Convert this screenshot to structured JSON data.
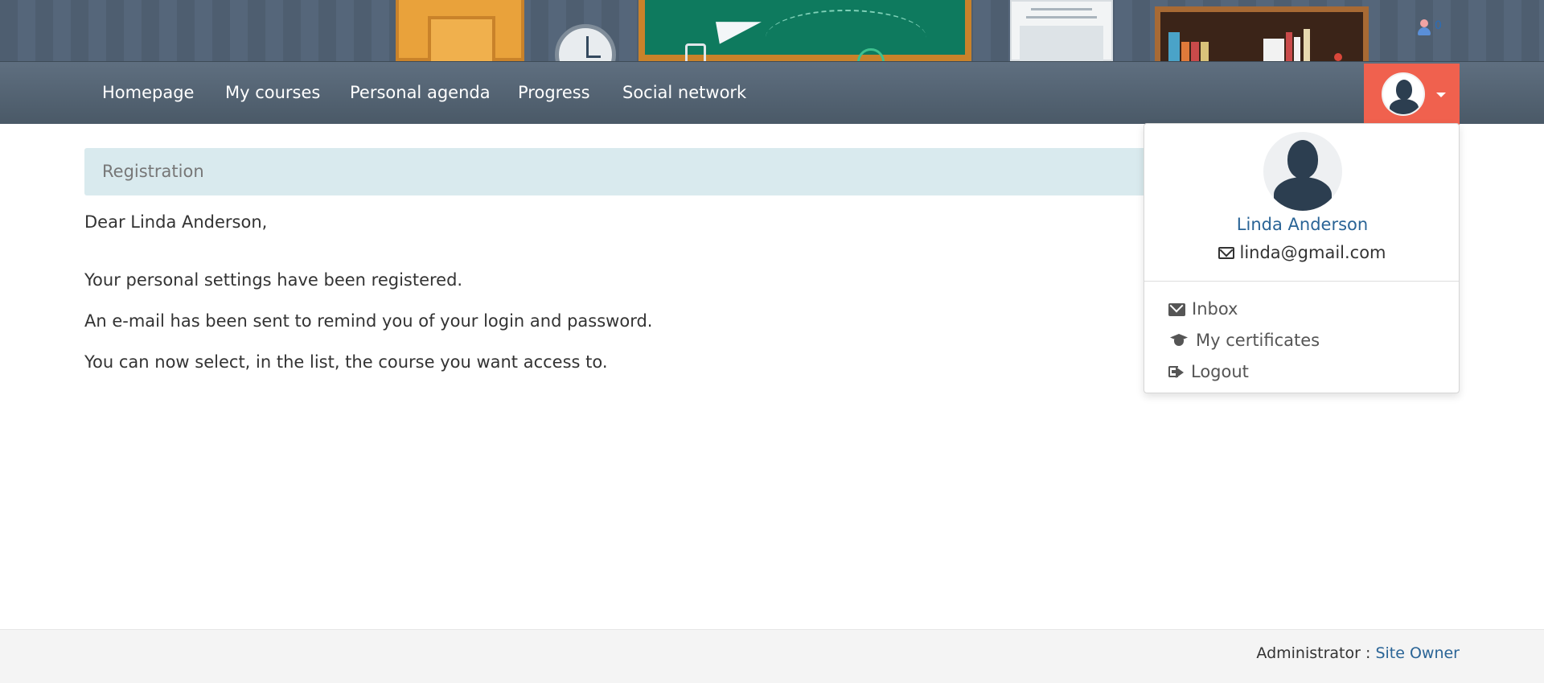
{
  "banner": {
    "notification_count": "0"
  },
  "nav": {
    "items": [
      {
        "label": "Homepage"
      },
      {
        "label": "My courses"
      },
      {
        "label": "Personal agenda"
      },
      {
        "label": "Progress"
      },
      {
        "label": "Social network"
      }
    ]
  },
  "breadcrumb": {
    "label": "Registration"
  },
  "message": {
    "greeting": "Dear Linda Anderson,",
    "line1": "Your personal settings have been registered.",
    "line2": "An e-mail has been sent to remind you of your login and password.",
    "line3": "You can now select, in the list, the course you want access to."
  },
  "user_menu": {
    "name": "Linda Anderson",
    "email": "linda@gmail.com",
    "items": [
      {
        "label": "Inbox",
        "icon": "envelope-icon"
      },
      {
        "label": "My certificates",
        "icon": "graduation-cap-icon"
      },
      {
        "label": "Logout",
        "icon": "sign-out-icon"
      }
    ]
  },
  "footer": {
    "admin_label": "Administrator :",
    "admin_name": "Site Owner"
  },
  "colors": {
    "navbar": "#4a5967",
    "accent": "#f0614e",
    "link": "#2a6496",
    "breadcrumb_bg": "#d9eaee"
  }
}
